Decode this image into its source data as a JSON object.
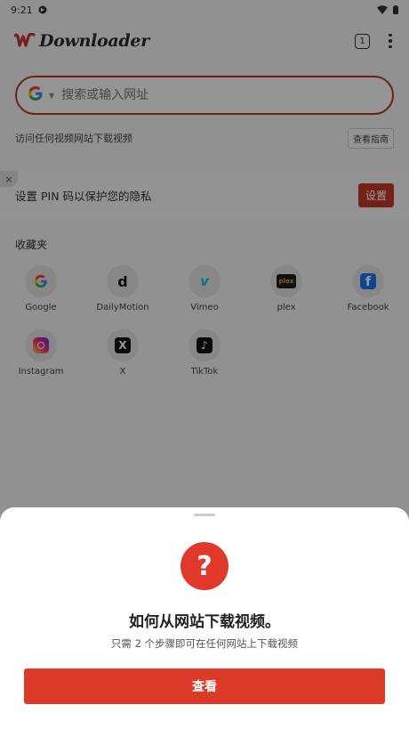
{
  "status_bar": {
    "time": "9:21"
  },
  "app": {
    "name": "Downloader",
    "open_tabs": "1"
  },
  "search": {
    "placeholder": "搜索或输入网址"
  },
  "hint": {
    "text": "访问任何视频网站下载视频",
    "guide_label": "查看指南"
  },
  "pin_banner": {
    "text": "设置 PIN 码以保护您的隐私",
    "button_label": "设置",
    "close_glyph": "×"
  },
  "favorites": {
    "title": "收藏夹",
    "items": [
      {
        "label": "Google",
        "icon": "google-icon"
      },
      {
        "label": "DailyMotion",
        "icon": "dailymotion-icon"
      },
      {
        "label": "Vimeo",
        "icon": "vimeo-icon"
      },
      {
        "label": "plex",
        "icon": "plex-icon"
      },
      {
        "label": "Facebook",
        "icon": "facebook-icon"
      },
      {
        "label": "Instagram",
        "icon": "instagram-icon"
      },
      {
        "label": "X",
        "icon": "x-icon"
      },
      {
        "label": "TikTok",
        "icon": "tiktok-icon"
      }
    ]
  },
  "sheet": {
    "icon_glyph": "?",
    "title": "如何从网站下载视频。",
    "subtitle": "只需 2 个步骤即可在任何网站上下载视频",
    "button_label": "查看"
  },
  "colors": {
    "accent": "#db3a28",
    "search_border": "#b03a2e"
  }
}
